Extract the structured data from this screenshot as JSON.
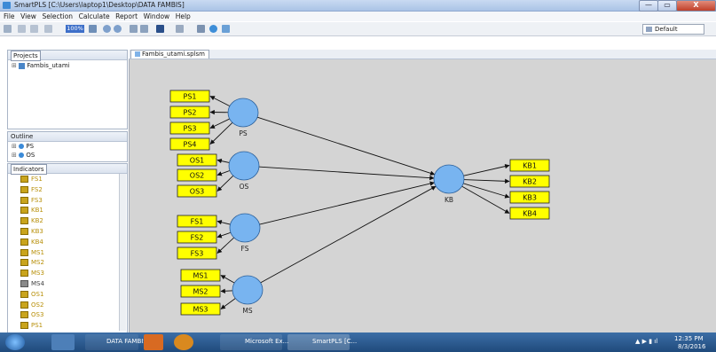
{
  "window": {
    "title": "SmartPLS [C:\\Users\\laptop1\\Desktop\\DATA FAMBIS]",
    "close_glyph": "X",
    "min_glyph": "—",
    "max_glyph": "▭"
  },
  "menu": [
    "File",
    "View",
    "Selection",
    "Calculate",
    "Report",
    "Window",
    "Help"
  ],
  "toolbar": {
    "zoom": "100%",
    "perspective": "Default"
  },
  "projects": {
    "title": "Projects",
    "tree": [
      "Fambis_utami"
    ]
  },
  "outline": {
    "title": "Outline",
    "items": [
      "PS",
      "OS"
    ]
  },
  "indicators": {
    "title": "Indicators",
    "items": [
      "FS1",
      "FS2",
      "FS3",
      "KB1",
      "KB2",
      "KB3",
      "KB4",
      "MS1",
      "MS2",
      "MS3",
      "MS4",
      "OS1",
      "OS2",
      "OS3",
      "PS1"
    ]
  },
  "editor": {
    "tab": "Fambis_utami.splsm"
  },
  "model": {
    "constructs": [
      "PS",
      "OS",
      "FS",
      "MS",
      "KB"
    ],
    "indicators": {
      "PS": [
        "PS1",
        "PS2",
        "PS3",
        "PS4"
      ],
      "OS": [
        "OS1",
        "OS2",
        "OS3"
      ],
      "FS": [
        "FS1",
        "FS2",
        "FS3"
      ],
      "MS": [
        "MS1",
        "MS2",
        "MS3"
      ],
      "KB": [
        "KB1",
        "KB2",
        "KB3",
        "KB4"
      ]
    },
    "paths": [
      [
        "PS",
        "KB"
      ],
      [
        "OS",
        "KB"
      ],
      [
        "FS",
        "KB"
      ],
      [
        "MS",
        "KB"
      ]
    ],
    "colors": {
      "construct": "#78b4f0",
      "indicator": "#ffff00",
      "canvas": "#d4d4d4"
    }
  },
  "taskbar": {
    "items": [
      "DATA FAMBIS",
      "Microsoft Ex...",
      "SmartPLS [C..."
    ],
    "time": "12:35 PM",
    "date": "8/3/2016"
  }
}
